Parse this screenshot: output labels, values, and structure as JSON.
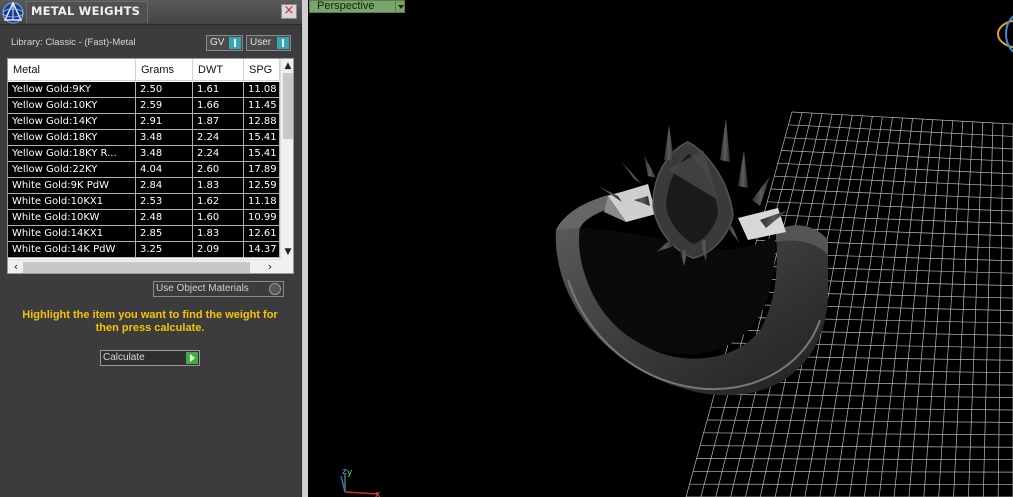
{
  "panel": {
    "title": "METAL WEIGHTS",
    "close": "×",
    "library_label": "Library: Classic - (Fast)-Metal",
    "gv_dropdown": "GV",
    "user_dropdown": "User",
    "use_object_materials": "Use Object Materials",
    "instruction": "Highlight the item you want to find the weight for then press calculate.",
    "calculate": "Calculate"
  },
  "table": {
    "columns": [
      "Metal",
      "Grams",
      "DWT",
      "SPG"
    ],
    "rows": [
      [
        "Yellow Gold:9KY",
        "2.50",
        "1.61",
        "11.08"
      ],
      [
        "Yellow Gold:10KY",
        "2.59",
        "1.66",
        "11.45"
      ],
      [
        "Yellow Gold:14KY",
        "2.91",
        "1.87",
        "12.88"
      ],
      [
        "Yellow Gold:18KY",
        "3.48",
        "2.24",
        "15.41"
      ],
      [
        "Yellow Gold:18KY R...",
        "3.48",
        "2.24",
        "15.41"
      ],
      [
        "Yellow Gold:22KY",
        "4.04",
        "2.60",
        "17.89"
      ],
      [
        "White Gold:9K PdW",
        "2.84",
        "1.83",
        "12.59"
      ],
      [
        "White Gold:10KX1",
        "2.53",
        "1.62",
        "11.18"
      ],
      [
        "White Gold:10KW",
        "2.48",
        "1.60",
        "10.99"
      ],
      [
        "White Gold:14KX1",
        "2.85",
        "1.83",
        "12.61"
      ],
      [
        "White Gold:14K PdW",
        "3.25",
        "2.09",
        "14.37"
      ]
    ]
  },
  "viewport": {
    "label": "Perspective",
    "axis_y": "y",
    "axis_z": "z",
    "axis_x": "x"
  }
}
